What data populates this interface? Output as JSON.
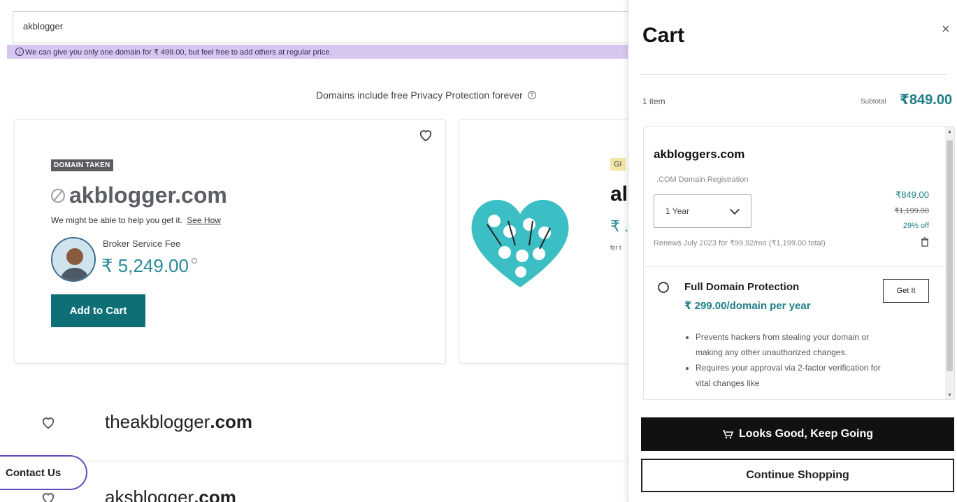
{
  "search": {
    "value": "akblogger",
    "notice": "We can give you only one domain for ₹ 499.00, but feel free to add others at regular price."
  },
  "privacy_note": "Domains include free Privacy Protection forever",
  "main_card": {
    "badge": "DOMAIN TAKEN",
    "domain": "akblogger.com",
    "help_text": "We might be able to help you get it.",
    "help_link": "See How",
    "broker_label": "Broker Service Fee",
    "broker_price": "₹ 5,249.00",
    "add_to_cart": "Add to Cart"
  },
  "second_card": {
    "badge": "GI",
    "name": "al",
    "price": "₹ .",
    "small": "for t"
  },
  "results": [
    {
      "prefix": "theakblogger",
      "tld": ".com"
    },
    {
      "prefix": "aksblogger",
      "tld": ".com"
    }
  ],
  "contact_button": "Contact Us",
  "cart": {
    "title": "Cart",
    "close": "×",
    "count": "1 item",
    "subtotal_label": "Subtotal",
    "subtotal": "₹849.00",
    "item": {
      "name": "akbloggers.com",
      "type": ".COM Domain Registration",
      "term": "1 Year",
      "price": "₹849.00",
      "old_price": "₹1,199.00",
      "discount": "29% off",
      "renewal": "Renews July 2023 for ₹99.92/mo (₹1,199.00 total)"
    },
    "protection": {
      "title": "Full Domain Protection",
      "price": "₹ 299.00/domain per year",
      "button": "Get It",
      "bullets": [
        "Prevents hackers from stealing your domain or making any other unauthorized changes.",
        "Requires your approval via 2-factor verification for vital changes like"
      ]
    },
    "primary_button": "Looks Good, Keep Going",
    "secondary_button": "Continue Shopping"
  },
  "colors": {
    "accent_teal": "#1f7f88",
    "button_teal": "#0f6f76",
    "notice_bg": "#d7c6ef"
  }
}
